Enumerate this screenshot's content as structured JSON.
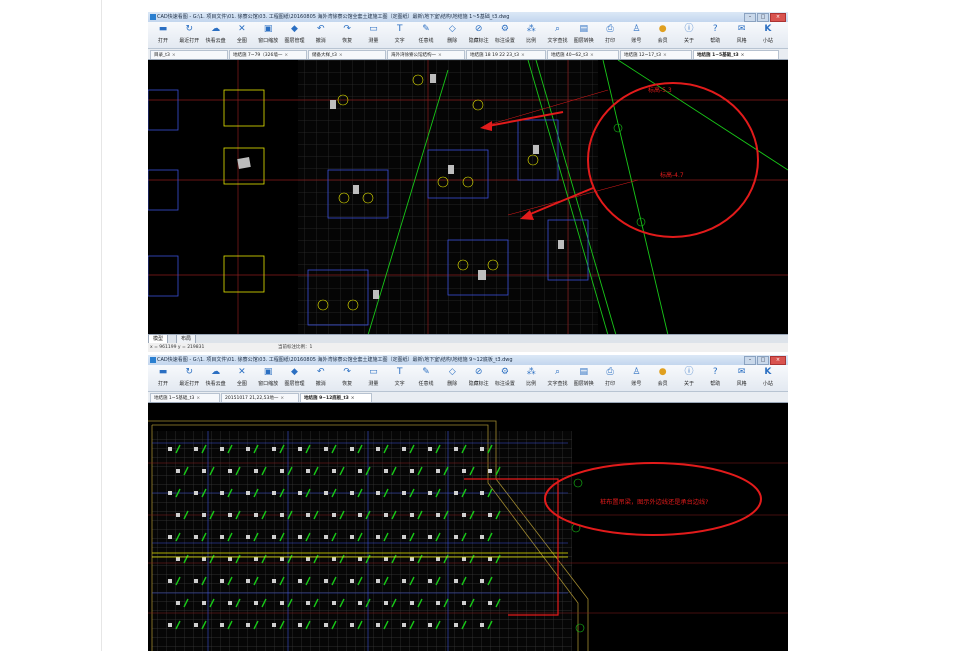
{
  "colors": {
    "annotation": "#e21b1b",
    "grid": "#1a1a1a",
    "cad_green": "#18c718",
    "cad_yellow": "#e6e600",
    "cad_blue": "#3a4fd8",
    "cad_red_line": "#a02020"
  },
  "shot1": {
    "title": "CAD快速看图 - G:\\1. 项目文件\\01. 徐寮公馆\\03. 工程图纸\\20160805 海外湾徐寮公馆全套土建施工图（定图纸）最新\\地下室\\结构\\地结施 1~5基础_t3.dwg",
    "toolbar": [
      {
        "icon": "open-icon",
        "glyph": "▬",
        "label": "打开"
      },
      {
        "icon": "recent-icon",
        "glyph": "↻",
        "label": "最近打开"
      },
      {
        "icon": "cloud-icon",
        "glyph": "☁",
        "label": "快看云盘"
      },
      {
        "icon": "fullview-icon",
        "glyph": "✕",
        "label": "全图"
      },
      {
        "icon": "window-zoom-icon",
        "glyph": "▣",
        "label": "窗口缩放"
      },
      {
        "icon": "layer-icon",
        "glyph": "◆",
        "label": "图层管理"
      },
      {
        "icon": "undo-icon",
        "glyph": "↶",
        "label": "撤消"
      },
      {
        "icon": "redo-icon",
        "glyph": "↷",
        "label": "恢复"
      },
      {
        "icon": "measure-icon",
        "glyph": "▭",
        "label": "测量"
      },
      {
        "icon": "text-icon",
        "glyph": "T",
        "label": "文字"
      },
      {
        "icon": "pen-icon",
        "glyph": "✎",
        "label": "任意线"
      },
      {
        "icon": "erase-icon",
        "glyph": "◇",
        "label": "删除"
      },
      {
        "icon": "hide-note-icon",
        "glyph": "⊘",
        "label": "隐藏标注"
      },
      {
        "icon": "annotate-settings-icon",
        "glyph": "⚙",
        "label": "标注设置"
      },
      {
        "icon": "scale-icon",
        "glyph": "⁂",
        "label": "比例"
      },
      {
        "icon": "find-text-icon",
        "glyph": "⌕",
        "label": "文字查找"
      },
      {
        "icon": "convert-icon",
        "glyph": "▤",
        "label": "图层转换"
      },
      {
        "icon": "print-icon",
        "glyph": "⎙",
        "label": "打印"
      },
      {
        "icon": "account-icon",
        "glyph": "♙",
        "label": "账号"
      },
      {
        "icon": "vip-icon",
        "glyph": "●",
        "label": "会员"
      },
      {
        "icon": "about-icon",
        "glyph": "ⓘ",
        "label": "关于"
      },
      {
        "icon": "help-icon",
        "glyph": "?",
        "label": "帮助"
      },
      {
        "icon": "feedback-icon",
        "glyph": "✉",
        "label": "风格"
      },
      {
        "icon": "k-icon",
        "glyph": "K",
        "label": "小站"
      }
    ],
    "tabs": [
      "目录_t3",
      "地结施 7~79（326墙一",
      "储备大样_t3",
      "海外湾徐寮公馆结构一",
      "地结施 18 19 22 23_t3",
      "地结施 40~62_t3",
      "地结施 12~17_t3",
      "地结施 1~5基础_t3"
    ],
    "annotations": [
      "标高-5.3",
      "标高-4.7"
    ],
    "layout_tabs": [
      "模型",
      "布局"
    ],
    "status_coords": "x = 961199  y = 219831",
    "status_scale": "当前标注比例：1"
  },
  "shot2": {
    "title": "CAD快速看图 - G:\\1. 项目文件\\01. 徐寮公馆\\03. 工程图纸\\20160805 海外湾徐寮公馆全套土建施工图（定图纸）最新\\地下室\\结构\\地结施 9~12底板_t3.dwg",
    "toolbar": [
      {
        "icon": "open-icon",
        "glyph": "▬",
        "label": "打开"
      },
      {
        "icon": "recent-icon",
        "glyph": "↻",
        "label": "最近打开"
      },
      {
        "icon": "cloud-icon",
        "glyph": "☁",
        "label": "快看云盘"
      },
      {
        "icon": "fullview-icon",
        "glyph": "✕",
        "label": "全图"
      },
      {
        "icon": "window-zoom-icon",
        "glyph": "▣",
        "label": "窗口缩放"
      },
      {
        "icon": "layer-icon",
        "glyph": "◆",
        "label": "图层管理"
      },
      {
        "icon": "undo-icon",
        "glyph": "↶",
        "label": "撤消"
      },
      {
        "icon": "redo-icon",
        "glyph": "↷",
        "label": "恢复"
      },
      {
        "icon": "measure-icon",
        "glyph": "▭",
        "label": "测量"
      },
      {
        "icon": "text-icon",
        "glyph": "T",
        "label": "文字"
      },
      {
        "icon": "pen-icon",
        "glyph": "✎",
        "label": "任意线"
      },
      {
        "icon": "erase-icon",
        "glyph": "◇",
        "label": "删除"
      },
      {
        "icon": "hide-note-icon",
        "glyph": "⊘",
        "label": "隐藏标注"
      },
      {
        "icon": "annotate-settings-icon",
        "glyph": "⚙",
        "label": "标注设置"
      },
      {
        "icon": "scale-icon",
        "glyph": "⁂",
        "label": "比例"
      },
      {
        "icon": "find-text-icon",
        "glyph": "⌕",
        "label": "文字查找"
      },
      {
        "icon": "convert-icon",
        "glyph": "▤",
        "label": "图层转换"
      },
      {
        "icon": "print-icon",
        "glyph": "⎙",
        "label": "打印"
      },
      {
        "icon": "account-icon",
        "glyph": "♙",
        "label": "账号"
      },
      {
        "icon": "vip-icon",
        "glyph": "●",
        "label": "会员"
      },
      {
        "icon": "about-icon",
        "glyph": "ⓘ",
        "label": "关于"
      },
      {
        "icon": "help-icon",
        "glyph": "?",
        "label": "帮助"
      },
      {
        "icon": "feedback-icon",
        "glyph": "✉",
        "label": "风格"
      },
      {
        "icon": "k-icon",
        "glyph": "K",
        "label": "小站"
      }
    ],
    "tabs": [
      "地结施 1~5基础_t3",
      "20151017 21,22,53地一",
      "地结施 9~12底板_t3"
    ],
    "annotations": [
      "桩布置吊梁，图示外边线还是承台边线?"
    ]
  }
}
